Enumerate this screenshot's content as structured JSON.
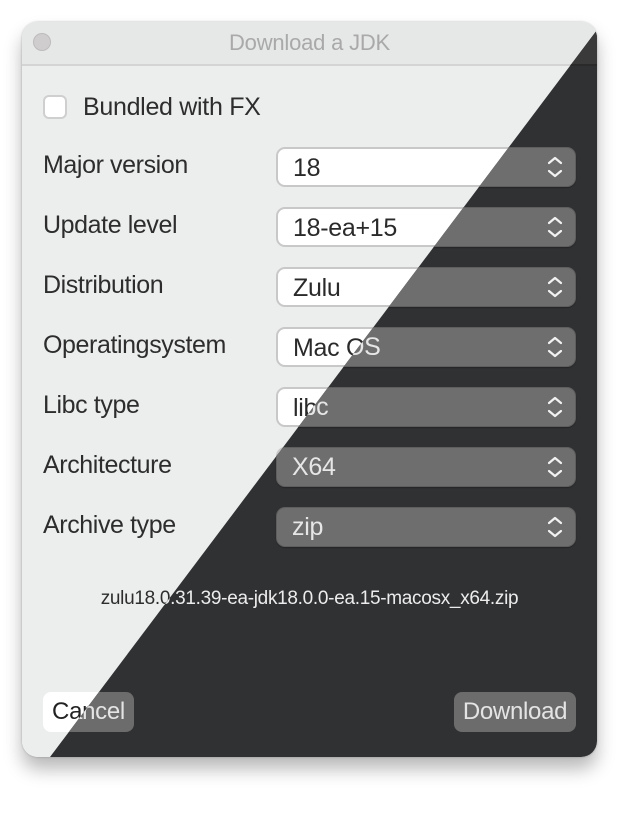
{
  "window": {
    "title": "Download a JDK"
  },
  "bundled_fx": {
    "label": "Bundled with FX",
    "checked": false
  },
  "fields": [
    {
      "label": "Major version",
      "value": "18"
    },
    {
      "label": "Update level",
      "value": "18-ea+15"
    },
    {
      "label": "Distribution",
      "value": "Zulu"
    },
    {
      "label": "Operatingsystem",
      "value": "Mac OS"
    },
    {
      "label": "Libc type",
      "value": "libc"
    },
    {
      "label": "Architecture",
      "value": "X64"
    },
    {
      "label": "Archive type",
      "value": "zip"
    }
  ],
  "filename": "zulu18.0.31.39-ea-jdk18.0.0-ea.15-macosx_x64.zip",
  "buttons": {
    "cancel": "Cancel",
    "download": "Download"
  },
  "theme": {
    "light_background": "#eceded",
    "dark_background": "#303133",
    "dark_control": "#6e6e6e"
  }
}
